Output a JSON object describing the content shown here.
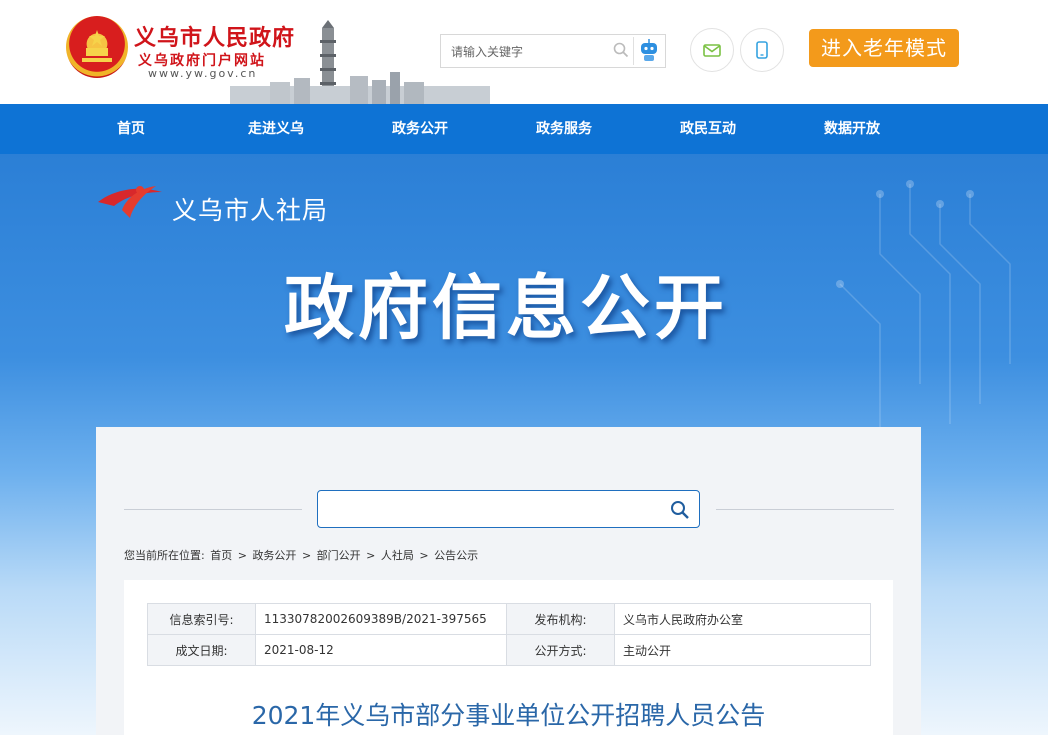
{
  "header": {
    "site_name": "义乌市人民政府",
    "site_sub": "义乌政府门户网站",
    "site_url": "www.yw.gov.cn",
    "search_placeholder": "请输入关键字",
    "search_icon": "magnifier-icon",
    "assistant_icon": "robot-icon",
    "mail_icon": "envelope-icon",
    "mobile_icon": "phone-icon",
    "elder_mode_label": "进入老年模式",
    "elder_color": "#f39a1b"
  },
  "nav": {
    "items": [
      {
        "label": "首页"
      },
      {
        "label": "走进义乌"
      },
      {
        "label": "政务公开"
      },
      {
        "label": "政务服务"
      },
      {
        "label": "政民互动"
      },
      {
        "label": "数据开放"
      }
    ],
    "color": "#0e73d5"
  },
  "banner": {
    "dept_name": "义乌市人社局",
    "title": "政府信息公开"
  },
  "content": {
    "search_placeholder": "",
    "breadcrumb": {
      "prefix": "您当前所在位置:",
      "items": [
        "首页",
        "政务公开",
        "部门公开",
        "人社局",
        "公告公示"
      ],
      "separator": ">"
    },
    "meta": {
      "index_label": "信息索引号:",
      "index_value": "11330782002609389B/2021-397565",
      "publisher_label": "发布机构:",
      "publisher_value": "义乌市人民政府办公室",
      "date_label": "成文日期:",
      "date_value": "2021-08-12",
      "mode_label": "公开方式:",
      "mode_value": "主动公开"
    },
    "doc_title": "2021年义乌市部分事业单位公开招聘人员公告",
    "title_color": "#2a67a8"
  }
}
